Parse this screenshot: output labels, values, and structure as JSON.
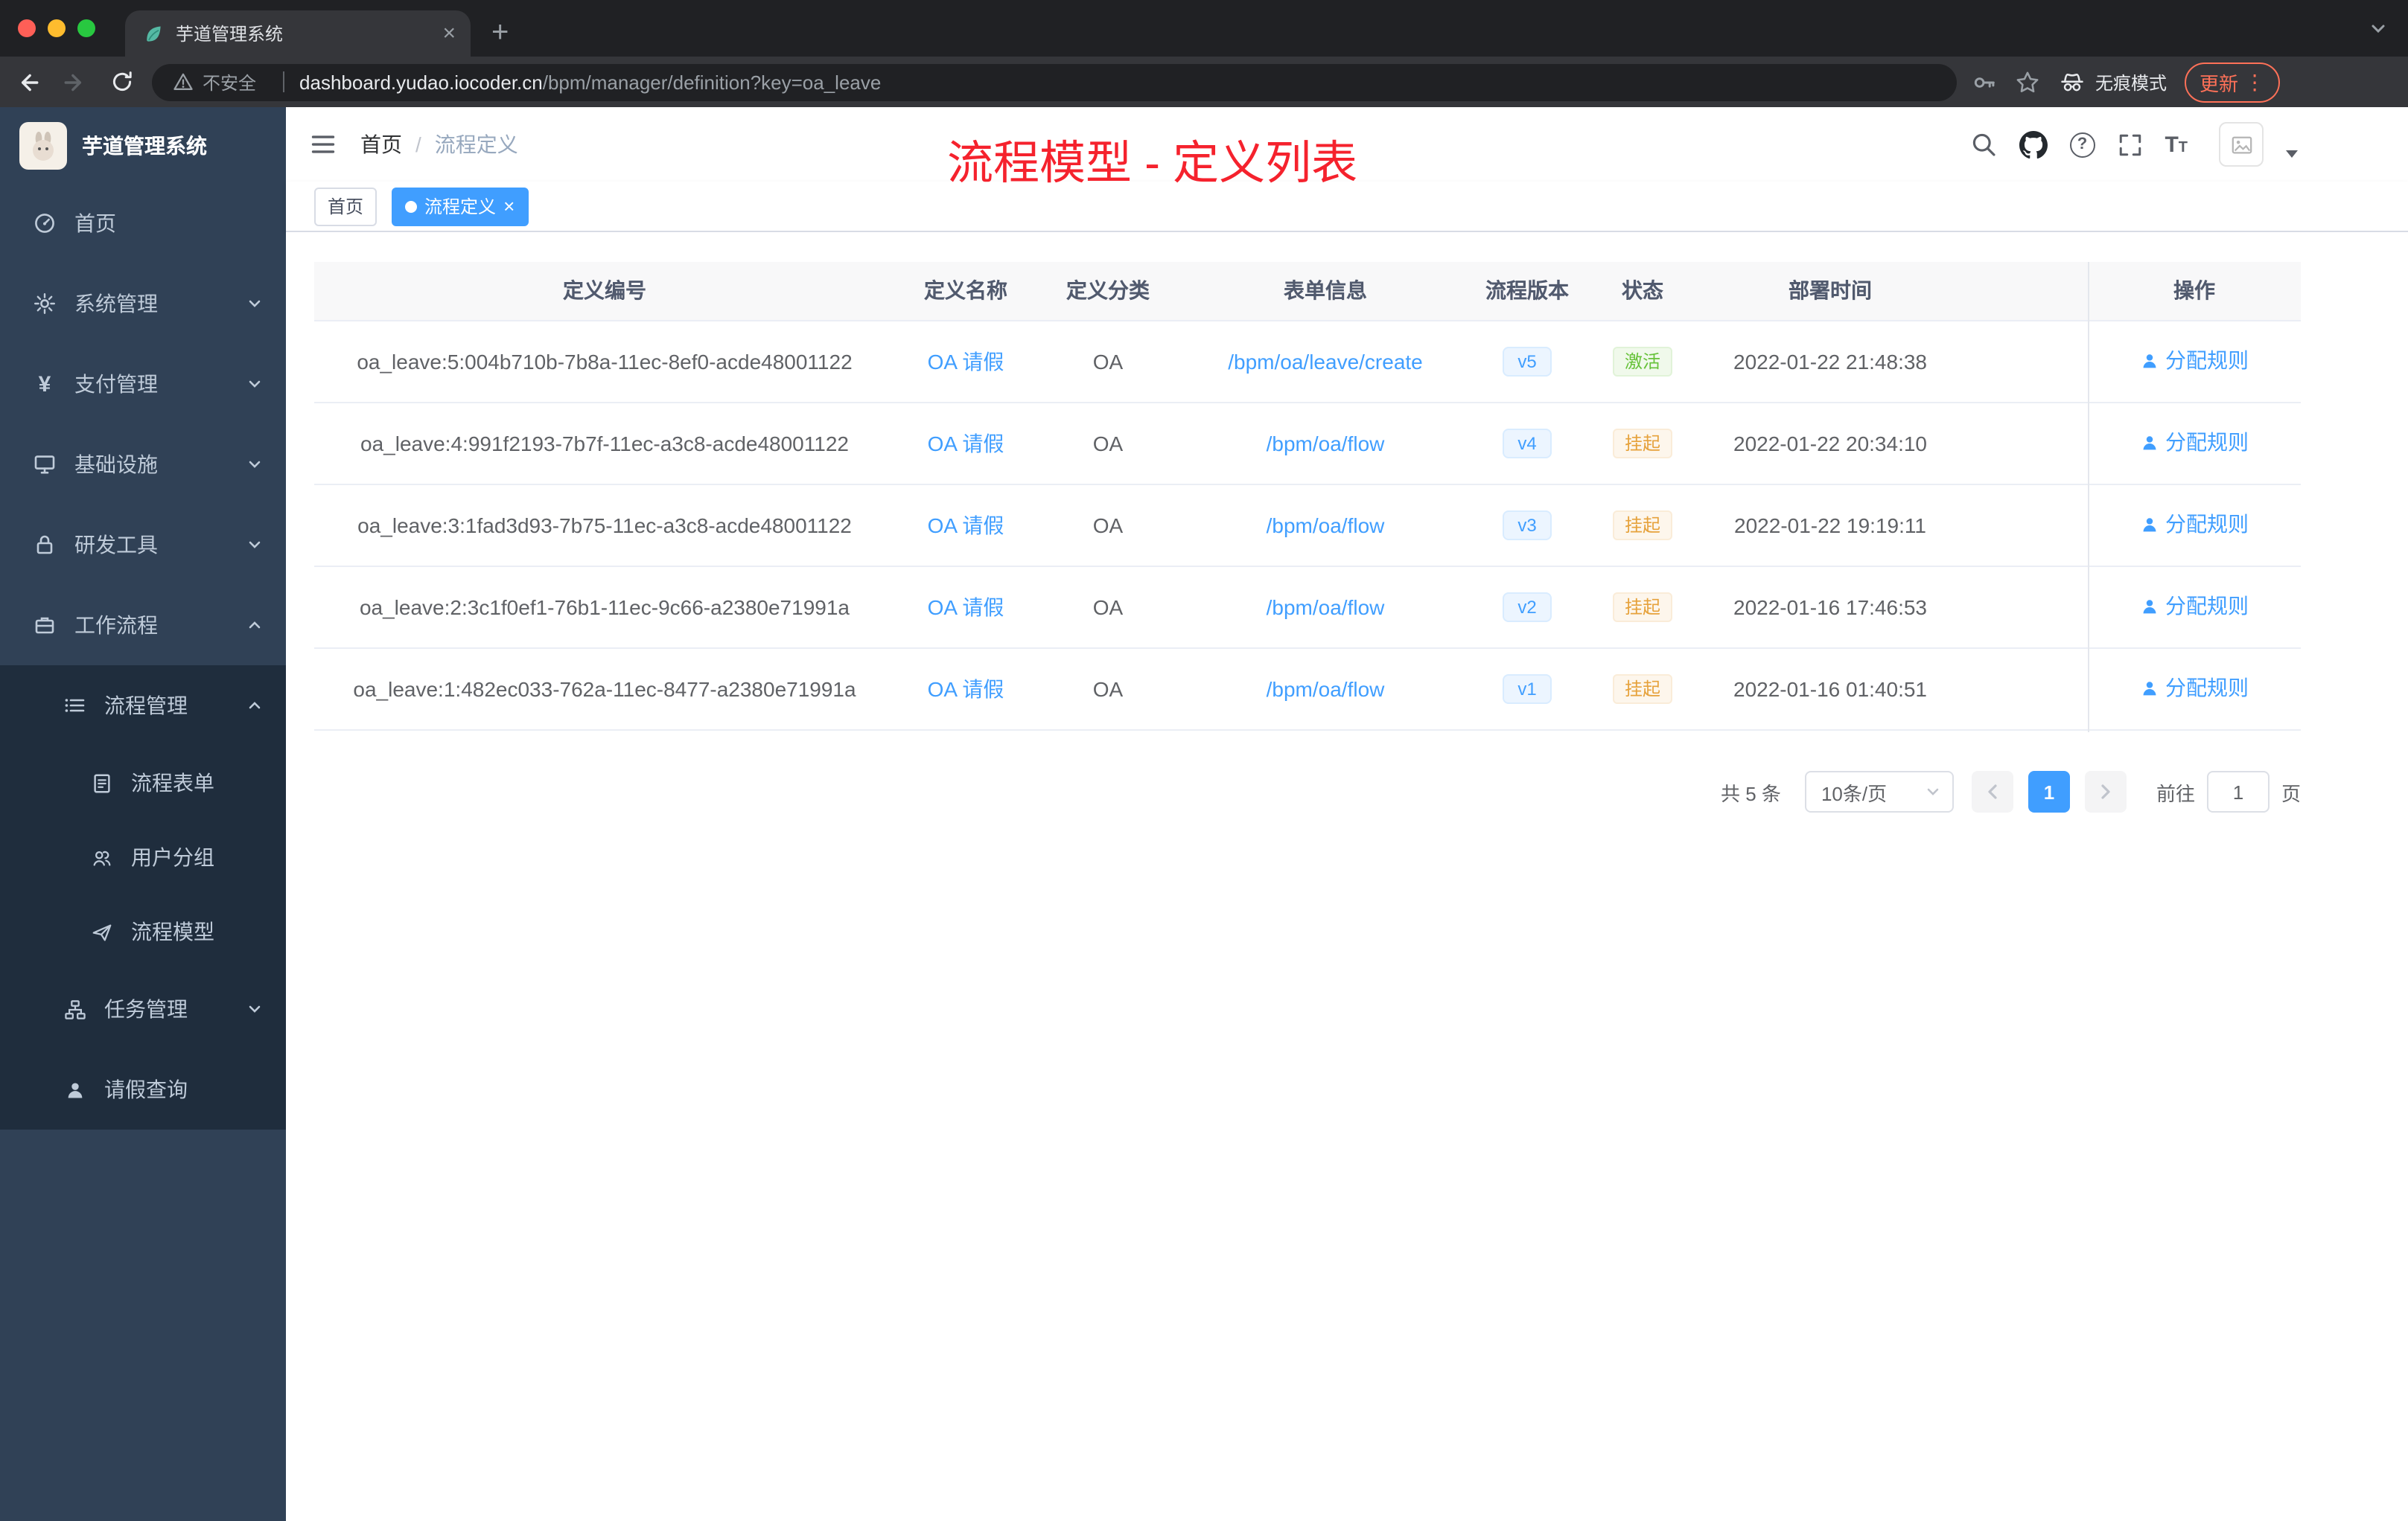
{
  "browser": {
    "tab_title": "芋道管理系统",
    "security_label": "不安全",
    "url_domain": "dashboard.yudao.iocoder.cn",
    "url_path": "/bpm/manager/definition?key=oa_leave",
    "incognito_label": "无痕模式",
    "update_label": "更新"
  },
  "sidebar": {
    "logo_title": "芋道管理系统",
    "items": [
      {
        "label": "首页"
      },
      {
        "label": "系统管理"
      },
      {
        "label": "支付管理"
      },
      {
        "label": "基础设施"
      },
      {
        "label": "研发工具"
      },
      {
        "label": "工作流程"
      },
      {
        "label": "流程管理"
      },
      {
        "label": "流程表单"
      },
      {
        "label": "用户分组"
      },
      {
        "label": "流程模型"
      },
      {
        "label": "任务管理"
      },
      {
        "label": "请假查询"
      }
    ]
  },
  "navbar": {
    "breadcrumb_home": "首页",
    "breadcrumb_sep": "/",
    "breadcrumb_current": "流程定义",
    "annotation": "流程模型 - 定义列表"
  },
  "tags": {
    "home": "首页",
    "active": "流程定义"
  },
  "table": {
    "columns": [
      "定义编号",
      "定义名称",
      "定义分类",
      "表单信息",
      "流程版本",
      "状态",
      "部署时间",
      "操作"
    ],
    "rows": [
      {
        "id": "oa_leave:5:004b710b-7b8a-11ec-8ef0-acde48001122",
        "name": "OA 请假",
        "category": "OA",
        "form": "/bpm/oa/leave/create",
        "version": "v5",
        "status": "激活",
        "time": "2022-01-22 21:48:38",
        "action": "分配规则"
      },
      {
        "id": "oa_leave:4:991f2193-7b7f-11ec-a3c8-acde48001122",
        "name": "OA 请假",
        "category": "OA",
        "form": "/bpm/oa/flow",
        "version": "v4",
        "status": "挂起",
        "time": "2022-01-22 20:34:10",
        "action": "分配规则"
      },
      {
        "id": "oa_leave:3:1fad3d93-7b75-11ec-a3c8-acde48001122",
        "name": "OA 请假",
        "category": "OA",
        "form": "/bpm/oa/flow",
        "version": "v3",
        "status": "挂起",
        "time": "2022-01-22 19:19:11",
        "action": "分配规则"
      },
      {
        "id": "oa_leave:2:3c1f0ef1-76b1-11ec-9c66-a2380e71991a",
        "name": "OA 请假",
        "category": "OA",
        "form": "/bpm/oa/flow",
        "version": "v2",
        "status": "挂起",
        "time": "2022-01-16 17:46:53",
        "action": "分配规则"
      },
      {
        "id": "oa_leave:1:482ec033-762a-11ec-8477-a2380e71991a",
        "name": "OA 请假",
        "category": "OA",
        "form": "/bpm/oa/flow",
        "version": "v1",
        "status": "挂起",
        "time": "2022-01-16 01:40:51",
        "action": "分配规则"
      }
    ]
  },
  "pagination": {
    "total": "共 5 条",
    "page_size": "10条/页",
    "current": "1",
    "goto_label": "前往",
    "goto_value": "1",
    "unit_label": "页"
  },
  "colors": {
    "accent": "#409eff",
    "success": "#67c23a",
    "warning": "#e6a23c",
    "annotation_red": "#f5222d",
    "sidebar_bg": "#304156",
    "sidebar_sub_bg": "#1f2d3d"
  }
}
